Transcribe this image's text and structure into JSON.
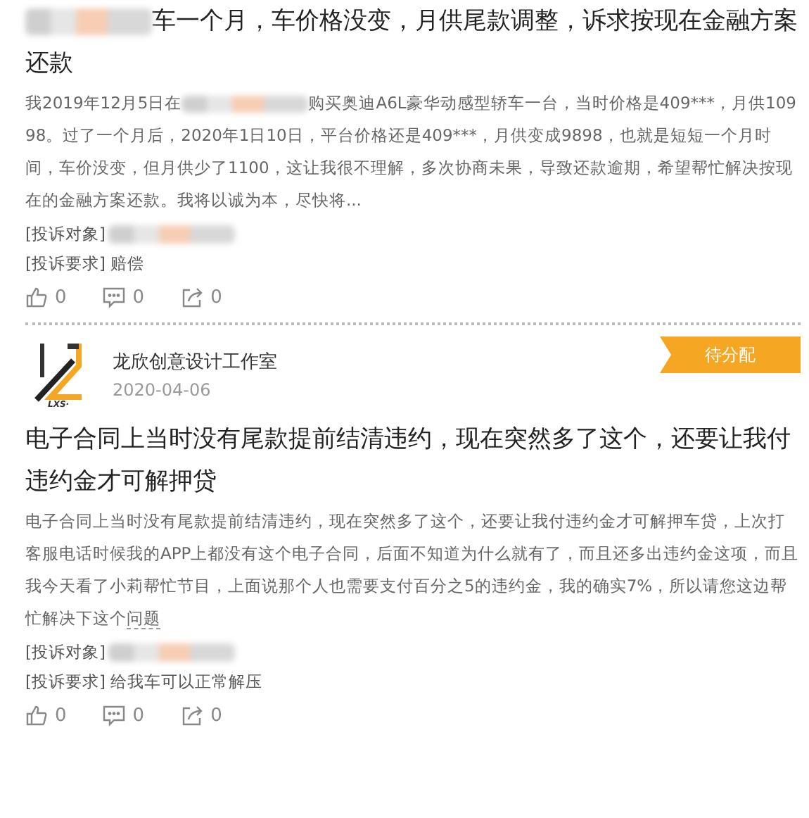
{
  "posts": [
    {
      "title": [
        {
          "kind": "redacted"
        },
        {
          "kind": "text",
          "text": "车一个月，车价格没变，月供尾款调整，诉求按现在金融方案还款"
        }
      ],
      "body": [
        {
          "kind": "text",
          "text": "我2019年12月5日在"
        },
        {
          "kind": "redacted"
        },
        {
          "kind": "text",
          "text": "购买奥迪A6L豪华动感型轿车一台，当时价格是409***，月供10998。过了一个月后，2020年1日10日，平台价格还是409***，月供变成9898，也就是短短一个月时间，车价没变，但月供少了1100，这让我很不理解，多次协商未果，导致还款逾期，希望帮忙解决按现在的金融方案还款。我将以诚为本，尽快将..."
        }
      ],
      "target": {
        "label": "[投诉对象]",
        "redacted": true
      },
      "request": {
        "label": "[投诉要求]",
        "value": "赔偿"
      },
      "actions": {
        "likes": "0",
        "comments": "0",
        "shares": "0"
      }
    },
    {
      "header": {
        "logo_text": "LXS·",
        "name": "龙欣创意设计工作室",
        "date": "2020-04-06",
        "status": "待分配"
      },
      "title": [
        {
          "kind": "text",
          "text": "电子合同上当时没有尾款提前结清违约，现在突然多了这个，还要让我付违约金才可解押贷"
        }
      ],
      "body": [
        {
          "kind": "text",
          "text": "电子合同上当时没有尾款提前结清违约，现在突然多了这个，还要让我付违约金才可解押车贷，上次打客服电话时候我的APP上都没有这个电子合同，后面不知道为什么就有了，而且还多出违约金这项，而且我今天看了小莉帮忙节目，上面说那个人也需要支付百分之5的违约金，我的确实7%，所以请您这边帮忙解决下这个"
        },
        {
          "kind": "link",
          "text": "问题"
        }
      ],
      "target": {
        "label": "[投诉对象]",
        "redacted": true
      },
      "request": {
        "label": "[投诉要求]",
        "value": "给我车可以正常解压"
      },
      "actions": {
        "likes": "0",
        "comments": "0",
        "shares": "0"
      }
    }
  ]
}
